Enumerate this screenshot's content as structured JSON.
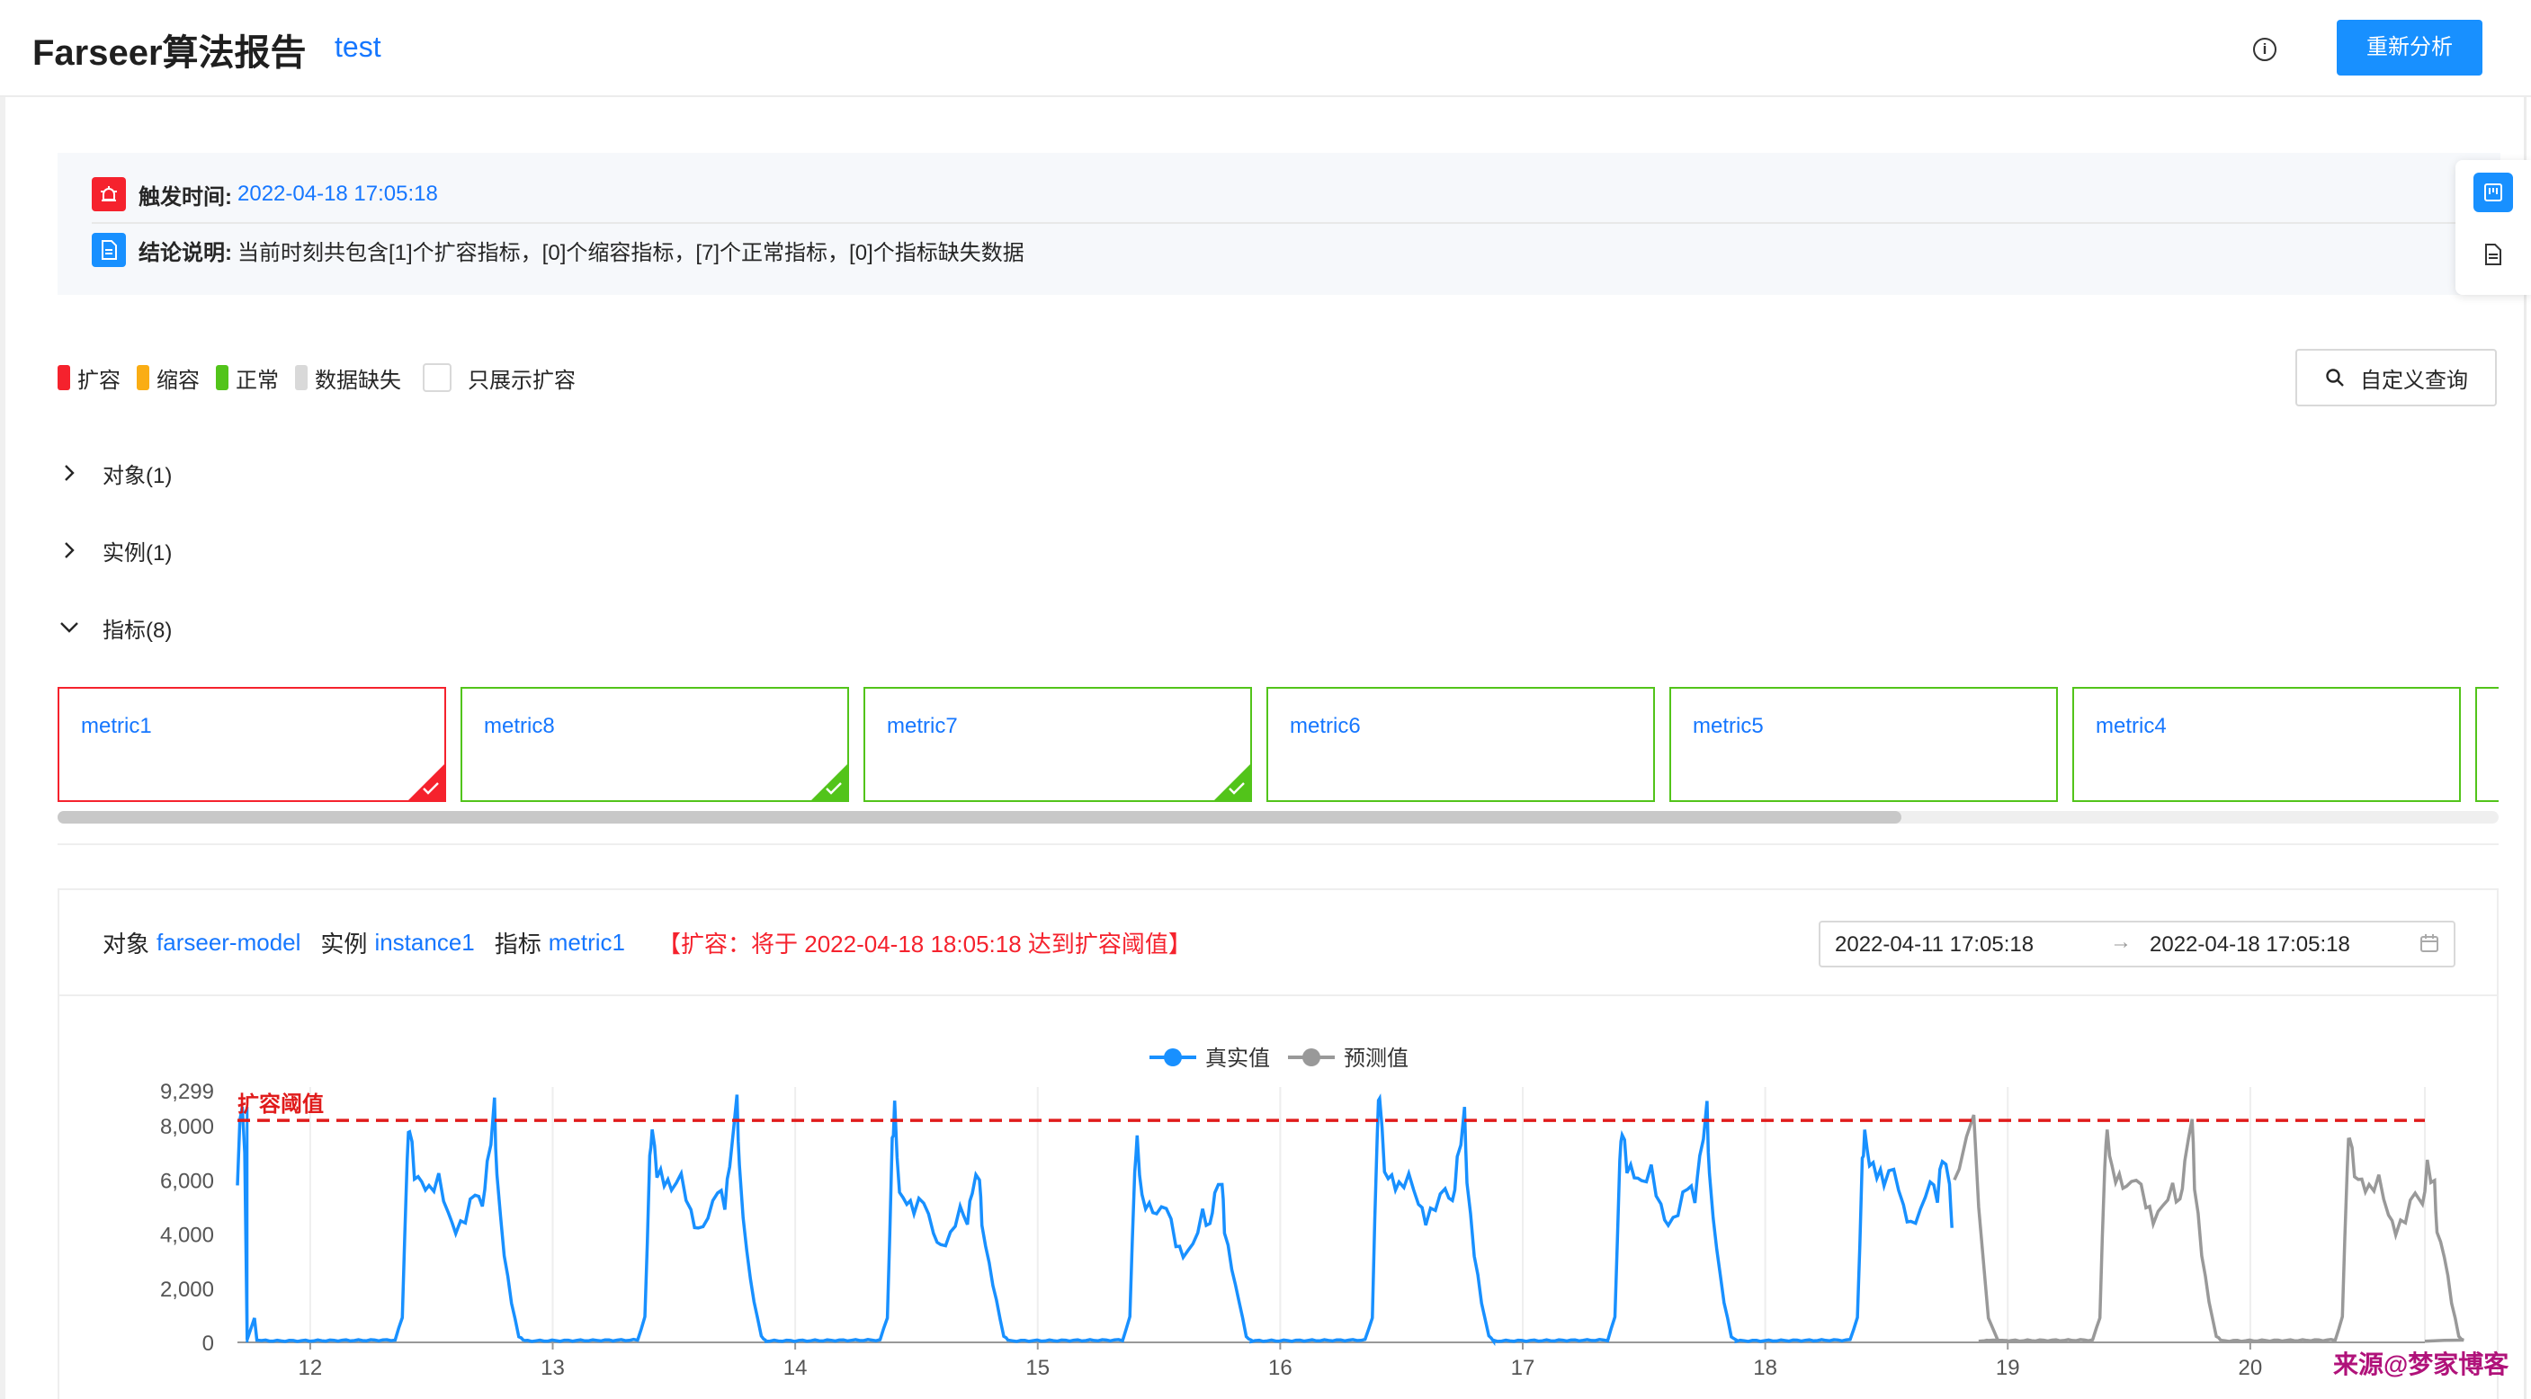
{
  "header": {
    "title": "Farseer算法报告",
    "subtitle": "test",
    "reanalyze_label": "重新分析"
  },
  "summary": {
    "trigger_label": "触发时间:",
    "trigger_time": "2022-04-18 17:05:18",
    "conclusion_label": "结论说明:",
    "conclusion_text": "当前时刻共包含[1]个扩容指标，[0]个缩容指标，[7]个正常指标，[0]个指标缺失数据"
  },
  "legend": {
    "items": [
      {
        "label": "扩容",
        "color": "#f5222d"
      },
      {
        "label": "缩容",
        "color": "#faad14"
      },
      {
        "label": "正常",
        "color": "#52c41a"
      },
      {
        "label": "数据缺失",
        "color": "#d9d9d9"
      }
    ],
    "only_expand_label": "只展示扩容"
  },
  "custom_query_label": "自定义查询",
  "sections": [
    {
      "label": "对象(1)",
      "expanded": false
    },
    {
      "label": "实例(1)",
      "expanded": false
    },
    {
      "label": "指标(8)",
      "expanded": true
    }
  ],
  "metrics": [
    {
      "name": "metric1",
      "status": "expand"
    },
    {
      "name": "metric8",
      "status": "normal"
    },
    {
      "name": "metric7",
      "status": "normal"
    },
    {
      "name": "metric6",
      "status": "normal"
    },
    {
      "name": "metric5",
      "status": "normal"
    },
    {
      "name": "metric4",
      "status": "normal"
    }
  ],
  "detail": {
    "object_key": "对象",
    "object_val": "farseer-model",
    "instance_key": "实例",
    "instance_val": "instance1",
    "metric_key": "指标",
    "metric_val": "metric1",
    "alert": "【扩容：将于 2022-04-18 18:05:18 达到扩容阈值】",
    "date_start": "2022-04-11 17:05:18",
    "date_end": "2022-04-18 17:05:18"
  },
  "chart_data": {
    "type": "line",
    "series": [
      {
        "name": "真实值",
        "color": "#1890ff"
      },
      {
        "name": "预测值",
        "color": "#999999"
      }
    ],
    "threshold_label": "扩容阈值",
    "threshold": 8200,
    "yticks": [
      0,
      2000,
      4000,
      6000,
      8000,
      9299
    ],
    "ylim": [
      0,
      9299
    ],
    "xticks": [
      "12",
      "13",
      "14",
      "15",
      "16",
      "17",
      "18",
      "19",
      "20"
    ],
    "x_range_days": [
      11.7,
      20.72
    ],
    "actual_peaks": [
      {
        "day": 12.4,
        "peak1": 8100,
        "mid": 5900,
        "low": 4100,
        "peak2": 8700
      },
      {
        "day": 13.4,
        "peak1": 7900,
        "mid": 6000,
        "low": 4100,
        "peak2": 9000
      },
      {
        "day": 14.4,
        "peak1": 8600,
        "mid": 5200,
        "low": 3500,
        "peak2": 6200
      },
      {
        "day": 15.4,
        "peak1": 7500,
        "mid": 5000,
        "low": 3200,
        "peak2": 6000
      },
      {
        "day": 16.4,
        "peak1": 9299,
        "mid": 6000,
        "low": 4500,
        "peak2": 8500
      },
      {
        "day": 17.4,
        "peak1": 7900,
        "mid": 6200,
        "low": 4300,
        "peak2": 8600
      },
      {
        "day": 18.4,
        "peak1": 7700,
        "mid": 6300,
        "low": 4300,
        "peak2": 5900
      }
    ],
    "predicted_peaks": [
      {
        "day": 19.4,
        "peak1": 7800,
        "mid": 6000,
        "low": 4500,
        "peak2": 8400
      },
      {
        "day": 20.4,
        "peak1": 7800,
        "mid": 5900,
        "low": 4100,
        "peak2": 5800
      }
    ]
  },
  "watermark": "来源@梦家博客"
}
